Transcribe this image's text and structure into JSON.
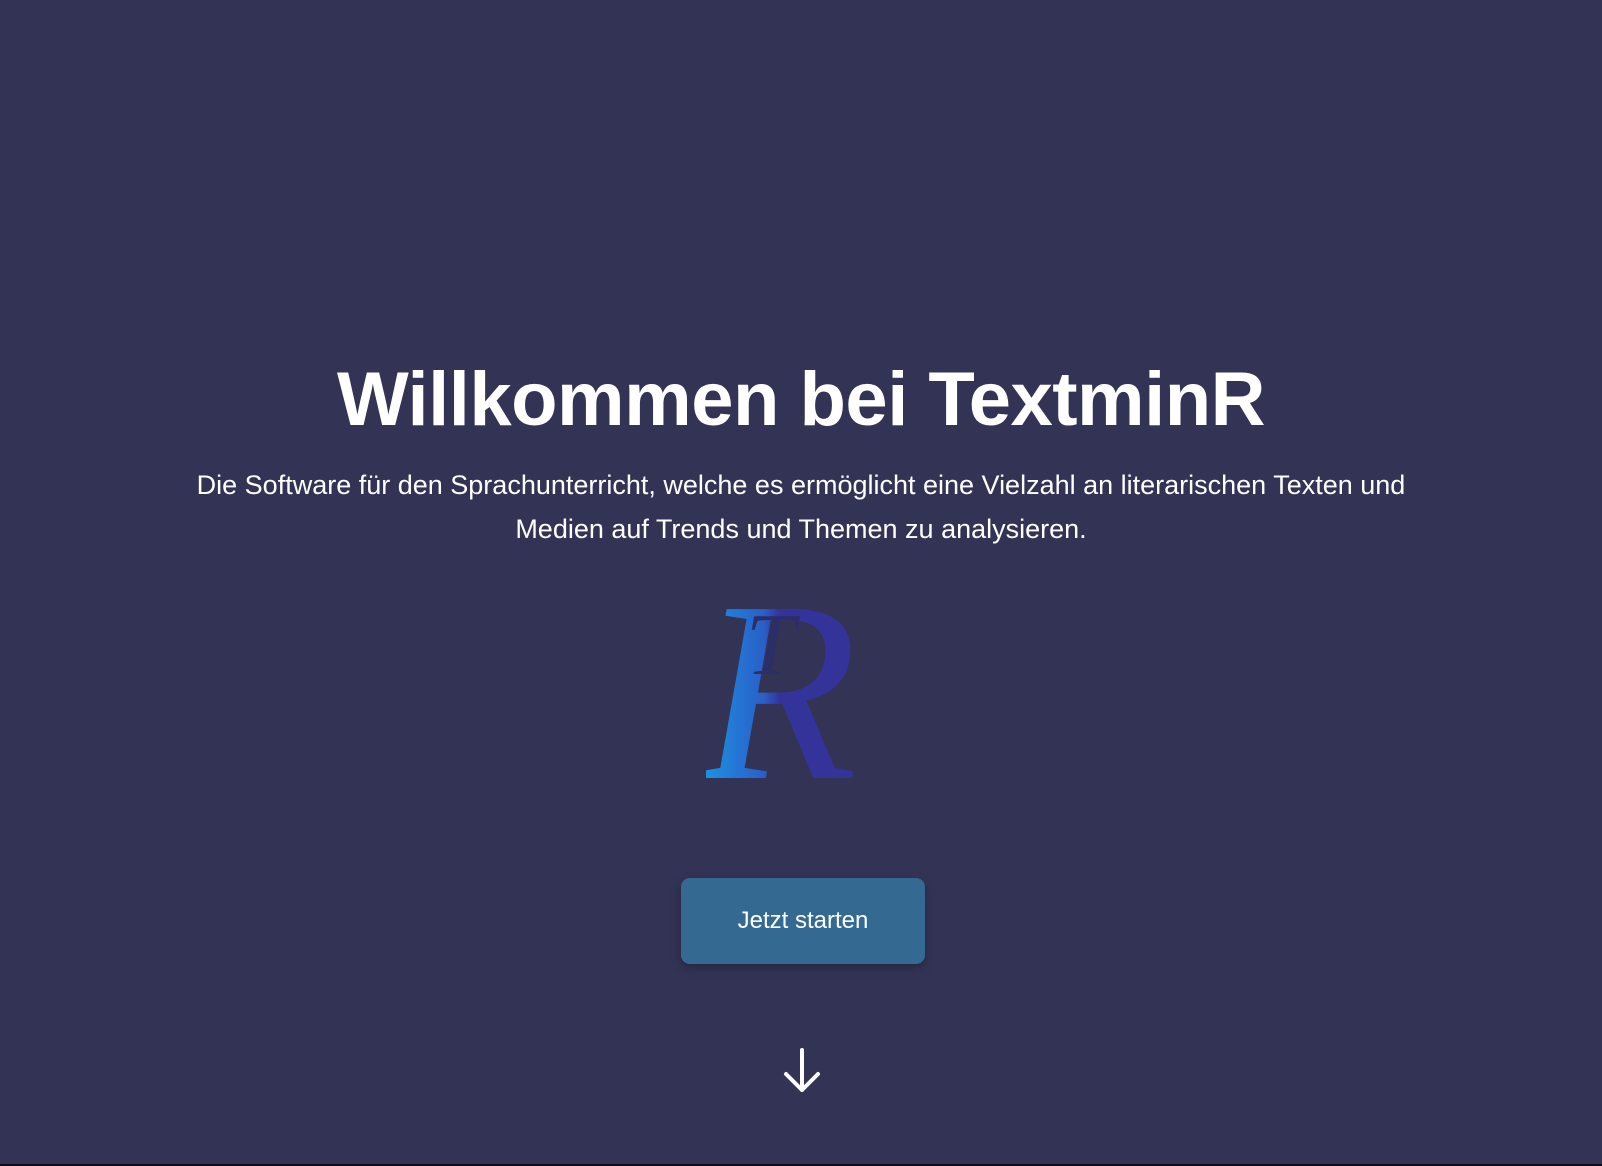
{
  "hero": {
    "title": "Willkommen bei TextminR",
    "subtitle": "Die Software für den Sprachunterricht, welche es ermöglicht eine Vielzahl an literarischen Texten und Medien auf Trends und Themen zu analysieren.",
    "logo_text": "TR",
    "start_button_label": "Jetzt starten",
    "scroll_icon": "arrow-down-icon"
  },
  "colors": {
    "background": "#333355",
    "button": "#346a92",
    "text": "#ffffff",
    "logo_gradient_start": "#1a9ae6",
    "logo_dark": "#333399"
  }
}
